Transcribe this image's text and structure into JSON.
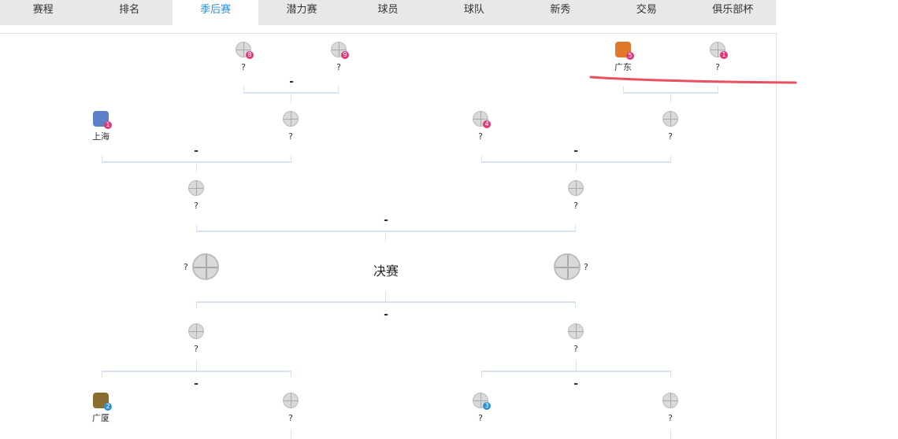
{
  "tabs": [
    "赛程",
    "排名",
    "季后赛",
    "潜力赛",
    "球员",
    "球队",
    "新秀",
    "交易",
    "俱乐部杯"
  ],
  "active_tab": "季后赛",
  "final_label": "决赛",
  "unknown": "?",
  "dash": "-",
  "teams": {
    "top_left_a": {
      "name": "?",
      "seed": "8"
    },
    "top_left_b": {
      "name": "?",
      "seed": "9"
    },
    "top_right_a": {
      "name": "广东",
      "seed": "5"
    },
    "top_right_b": {
      "name": "?",
      "seed": "1"
    },
    "r2_sh": {
      "name": "上海",
      "seed": "1"
    },
    "r2_q1": {
      "name": "?"
    },
    "r2_seed4": {
      "name": "?",
      "seed": "4"
    },
    "r2_q2": {
      "name": "?"
    },
    "semi_left": {
      "name": "?"
    },
    "semi_right": {
      "name": "?"
    },
    "final_left": {
      "name": "?"
    },
    "final_right": {
      "name": "?"
    },
    "low_semi_left": {
      "name": "?"
    },
    "low_semi_right": {
      "name": "?"
    },
    "gs": {
      "name": "广厦",
      "seed": "2"
    },
    "low_q1": {
      "name": "?"
    },
    "seed3": {
      "name": "?",
      "seed": "3"
    },
    "low_q2": {
      "name": "?"
    }
  },
  "colors": {
    "accent": "#2a8fd6",
    "seed_pink": "#e0367a",
    "seed_blue": "#2d8fd8",
    "annotation": "#e85060"
  }
}
